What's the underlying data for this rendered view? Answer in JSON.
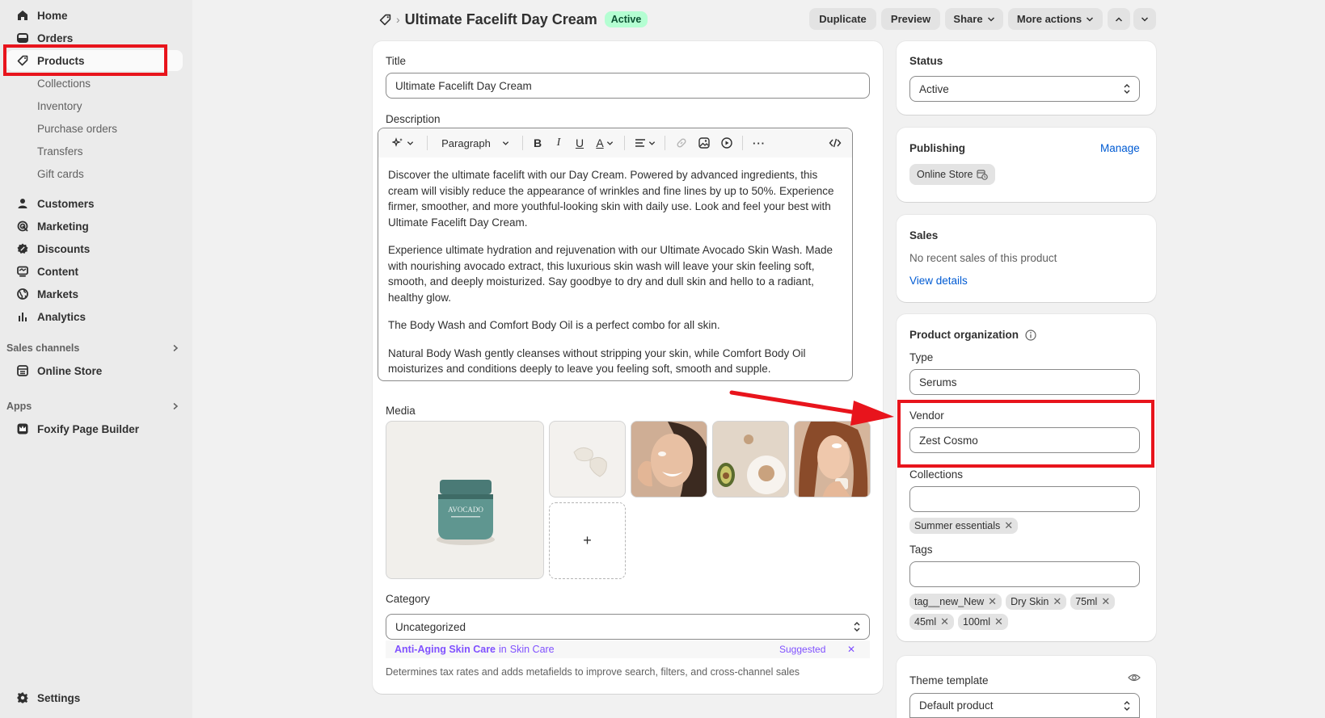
{
  "sidebar": {
    "items": [
      {
        "label": "Home",
        "icon": "home-icon"
      },
      {
        "label": "Orders",
        "icon": "inbox-icon"
      },
      {
        "label": "Products",
        "icon": "tag-icon"
      }
    ],
    "sub_items": [
      "Collections",
      "Inventory",
      "Purchase orders",
      "Transfers",
      "Gift cards"
    ],
    "items2": [
      {
        "label": "Customers",
        "icon": "person-icon"
      },
      {
        "label": "Marketing",
        "icon": "target-icon"
      },
      {
        "label": "Discounts",
        "icon": "discount-icon"
      },
      {
        "label": "Content",
        "icon": "content-icon"
      },
      {
        "label": "Markets",
        "icon": "globe-icon"
      },
      {
        "label": "Analytics",
        "icon": "chart-icon"
      }
    ],
    "sales_channels_label": "Sales channels",
    "online_store": "Online Store",
    "apps_label": "Apps",
    "app_item": "Foxify Page Builder",
    "settings": "Settings"
  },
  "header": {
    "title": "Ultimate Facelift Day Cream",
    "status_badge": "Active",
    "duplicate": "Duplicate",
    "preview": "Preview",
    "share": "Share",
    "more_actions": "More actions"
  },
  "main": {
    "title_label": "Title",
    "title_value": "Ultimate Facelift Day Cream",
    "description_label": "Description",
    "toolbar_paragraph": "Paragraph",
    "description_paragraphs": [
      "Discover the ultimate facelift with our Day Cream. Powered by advanced ingredients, this cream will visibly reduce the appearance of wrinkles and fine lines by up to 50%. Experience firmer, smoother, and more youthful-looking skin with daily use. Look and feel your best with Ultimate Facelift Day Cream.",
      "Experience ultimate hydration and rejuvenation with our Ultimate Avocado Skin Wash. Made with nourishing avocado extract, this luxurious skin wash will leave your skin feeling soft, smooth, and deeply moisturized. Say goodbye to dry and dull skin and hello to a radiant, healthy glow.",
      "The Body Wash and Comfort Body Oil is a perfect combo for all skin.",
      "Natural Body Wash gently cleanses without stripping your skin, while Comfort Body Oil moisturizes and conditions deeply to leave you feeling soft, smooth and supple."
    ],
    "media_label": "Media",
    "media_jar_text": "AVOCADO",
    "add_media": "+",
    "category_label": "Category",
    "category_value": "Uncategorized",
    "suggestion_category": "Anti-Aging Skin Care",
    "suggestion_in": "in",
    "suggestion_parent": "Skin Care",
    "suggested_label": "Suggested",
    "suggestion_dismiss": "✕",
    "category_help": "Determines tax rates and adds metafields to improve search, filters, and cross-channel sales"
  },
  "right": {
    "status_label": "Status",
    "status_value": "Active",
    "publishing_label": "Publishing",
    "manage": "Manage",
    "online_store_chip": "Online Store",
    "sales_label": "Sales",
    "sales_text": "No recent sales of this product",
    "view_details": "View details",
    "org_label": "Product organization",
    "type_label": "Type",
    "type_value": "Serums",
    "vendor_label": "Vendor",
    "vendor_value": "Zest Cosmo",
    "collections_label": "Collections",
    "collections_value": "",
    "collection_chips": [
      "Summer essentials"
    ],
    "tags_label": "Tags",
    "tags_value": "",
    "tag_chips": [
      "tag__new_New",
      "Dry Skin",
      "75ml",
      "45ml",
      "100ml"
    ],
    "theme_label": "Theme template",
    "theme_value": "Default product"
  },
  "colors": {
    "highlight": "#e8141c",
    "link": "#005bd3",
    "suggest": "#8051ff",
    "badge_bg": "#b4fed2"
  }
}
